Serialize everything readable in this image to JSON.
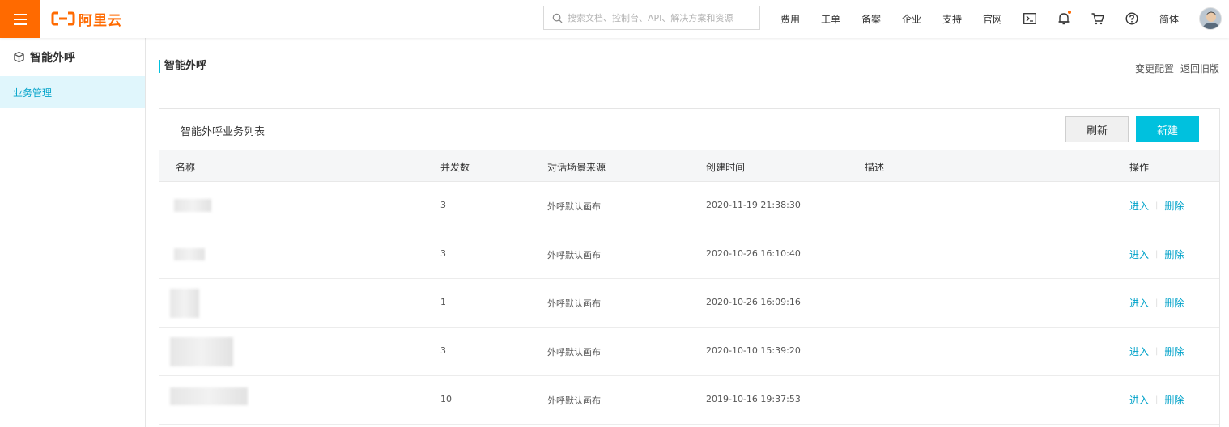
{
  "topbar": {
    "logo_text": "阿里云",
    "search_placeholder": "搜索文档、控制台、API、解决方案和资源",
    "nav": [
      "费用",
      "工单",
      "备案",
      "企业",
      "支持",
      "官网"
    ],
    "lang": "简体",
    "brand_color": "#ff6a00"
  },
  "sidebar": {
    "title": "智能外呼",
    "items": [
      {
        "label": "业务管理",
        "active": true
      }
    ]
  },
  "page": {
    "title": "智能外呼",
    "links": [
      "变更配置",
      "返回旧版"
    ]
  },
  "panel": {
    "title": "智能外呼业务列表",
    "refresh_label": "刷新",
    "new_label": "新建",
    "columns": [
      "名称",
      "并发数",
      "对话场景来源",
      "创建时间",
      "描述",
      "操作"
    ],
    "rows": [
      {
        "concurrency": "3",
        "source": "外呼默认画布",
        "created": "2020-11-19 21:38:30",
        "enter": "进入",
        "delete": "删除"
      },
      {
        "concurrency": "3",
        "source": "外呼默认画布",
        "created": "2020-10-26 16:10:40",
        "enter": "进入",
        "delete": "删除"
      },
      {
        "concurrency": "1",
        "source": "外呼默认画布",
        "created": "2020-10-26 16:09:16",
        "enter": "进入",
        "delete": "删除"
      },
      {
        "concurrency": "3",
        "source": "外呼默认画布",
        "created": "2020-10-10 15:39:20",
        "enter": "进入",
        "delete": "删除"
      },
      {
        "concurrency": "10",
        "source": "外呼默认画布",
        "created": "2019-10-16 19:37:53",
        "enter": "进入",
        "delete": "删除"
      }
    ]
  },
  "accent_color": "#00c1de"
}
